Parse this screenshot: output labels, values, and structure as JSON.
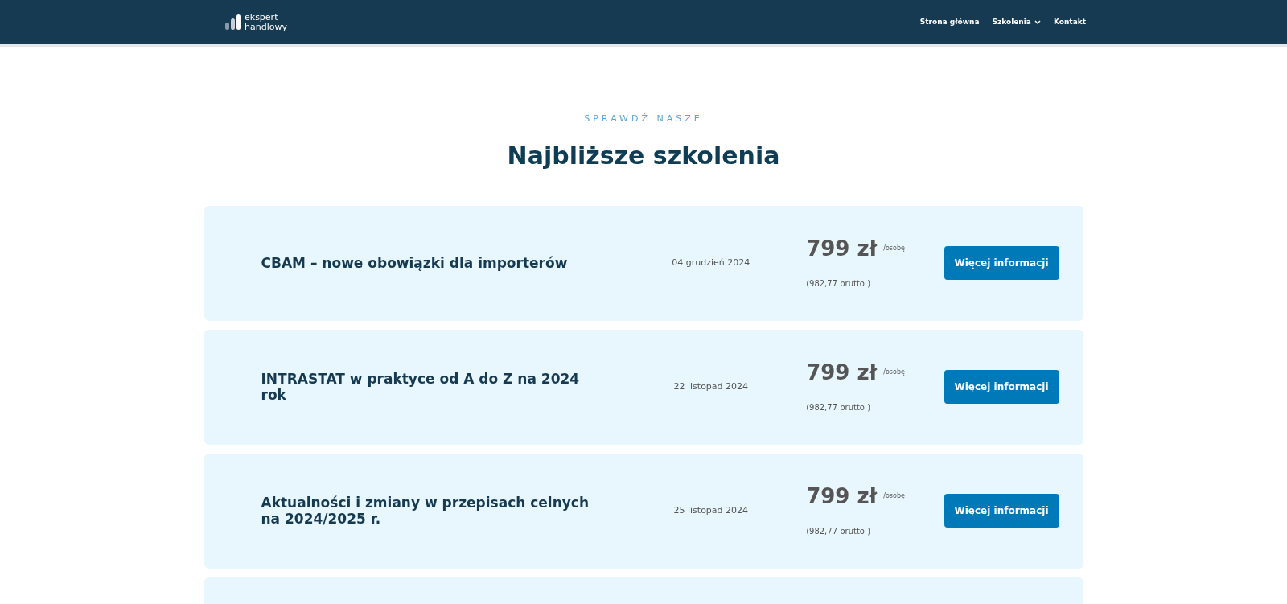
{
  "header": {
    "logo": {
      "line_1": "ekspert",
      "line_2": "handlowy"
    },
    "nav": [
      {
        "label": "Strona główna",
        "kind": "link"
      },
      {
        "label": "Szkolenia",
        "kind": "dropdown"
      },
      {
        "label": "Kontakt",
        "kind": "link"
      }
    ]
  },
  "section": {
    "eyebrow": "SPRAWDŹ NASZE",
    "title": "Najbliższe szkolenia"
  },
  "trainings": [
    {
      "title": "CBAM – nowe obowiązki dla importerów",
      "date": "04 grudzień 2024",
      "price": "799 zł",
      "per": "/osobę",
      "gross": "(982,77 brutto )",
      "button": "Więcej informacji"
    },
    {
      "title": "INTRASTAT w praktyce od A do Z na 2024 rok",
      "date": "22 listopad 2024",
      "price": "799 zł",
      "per": "/osobę",
      "gross": "(982,77 brutto )",
      "button": "Więcej informacji"
    },
    {
      "title": "Aktualności i zmiany w przepisach celnych na 2024/2025 r.",
      "date": "25 listopad 2024",
      "price": "799 zł",
      "per": "/osobę",
      "gross": "(982,77 brutto )",
      "button": "Więcej informacji"
    }
  ]
}
